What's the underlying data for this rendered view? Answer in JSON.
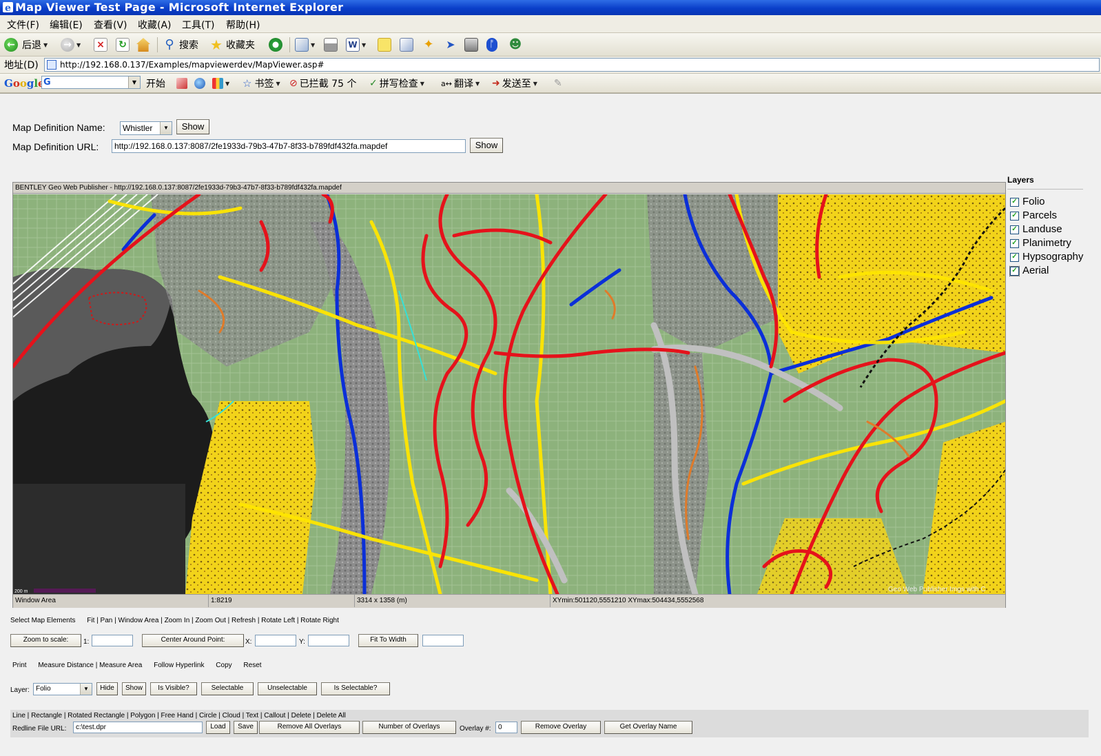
{
  "window": {
    "title": "Map Viewer Test Page - Microsoft Internet Explorer"
  },
  "menu": [
    "文件(F)",
    "编辑(E)",
    "查看(V)",
    "收藏(A)",
    "工具(T)",
    "帮助(H)"
  ],
  "toolbar": {
    "back": "后退",
    "search": "搜索",
    "favorites": "收藏夹"
  },
  "address": {
    "label": "地址(D)",
    "url": "http://192.168.0.137/Examples/mapviewerdev/MapViewer.asp#"
  },
  "google_bar": {
    "start": "开始",
    "bookmarks": "书签",
    "blocked": "已拦截 75 个",
    "spellcheck": "拼写检查",
    "translate": "翻译",
    "sendto": "发送至"
  },
  "map_def": {
    "name_label": "Map Definition Name:",
    "name_value": "Whistler",
    "show": "Show",
    "url_label": "Map Definition URL:",
    "url_value": "http://192.168.0.137:8087/2fe1933d-79b3-47b7-8f33-b789fdf432fa.mapdef"
  },
  "map": {
    "header": "BENTLEY Geo Web Publisher - http://192.168.0.137:8087/2fe1933d-79b3-47b7-8f33-b789fdf432fa.mapdef",
    "watermark": "Geo Web Publisher Imgs with C",
    "scalebar": "200 m",
    "status": {
      "mode": "Window Area",
      "scale": "1:8219",
      "extent": "3314 x 1358 (m)",
      "bbox": "XYmin:501120,5551210  XYmax:504434,5552568"
    }
  },
  "layers": {
    "title": "Layers",
    "items": [
      {
        "name": "Folio",
        "checked": true
      },
      {
        "name": "Parcels",
        "checked": true
      },
      {
        "name": "Landuse",
        "checked": true
      },
      {
        "name": "Planimetry",
        "checked": true
      },
      {
        "name": "Hypsography",
        "checked": true
      },
      {
        "name": "Aerial",
        "checked": true
      }
    ]
  },
  "commands": {
    "select": "Select Map Elements",
    "nav": [
      "Fit",
      "Pan",
      "Window Area",
      "Zoom In",
      "Zoom Out",
      "Refresh",
      "Rotate Left",
      "Rotate Right"
    ],
    "zoom_to_scale": "Zoom to scale:",
    "scale_prefix": "1:",
    "center_around": "Center Around Point:",
    "x_label": "X:",
    "y_label": "Y:",
    "fit_to_width": "Fit To Width",
    "print": "Print",
    "measure": [
      "Measure Distance",
      "Measure Area"
    ],
    "follow": "Follow Hyperlink",
    "copy": "Copy",
    "reset": "Reset",
    "layer_label": "Layer:",
    "layer_value": "Folio",
    "hide": "Hide",
    "show": "Show",
    "is_visible": "Is Visible?",
    "selectable": "Selectable",
    "unselectable": "Unselectable",
    "is_selectable": "Is Selectable?"
  },
  "redline": {
    "tools": [
      "Line",
      "Rectangle",
      "Rotated Rectangle",
      "Polygon",
      "Free Hand",
      "Circle",
      "Cloud",
      "Text",
      "Callout",
      "Delete",
      "Delete All"
    ],
    "file_label": "Redline File URL:",
    "file_value": "c:\\test.dpr",
    "load": "Load",
    "save": "Save",
    "remove_all": "Remove All Overlays",
    "num_overlays": "Number of Overlays",
    "overlay_label": "Overlay #:",
    "overlay_value": "0",
    "remove_overlay": "Remove Overlay",
    "get_overlay_name": "Get Overlay Name"
  },
  "colors": {
    "road_red": "#e5121b",
    "road_yellow": "#ffe600",
    "water_blue": "#0b2fd8",
    "landuse_green": "#8fb27a"
  }
}
